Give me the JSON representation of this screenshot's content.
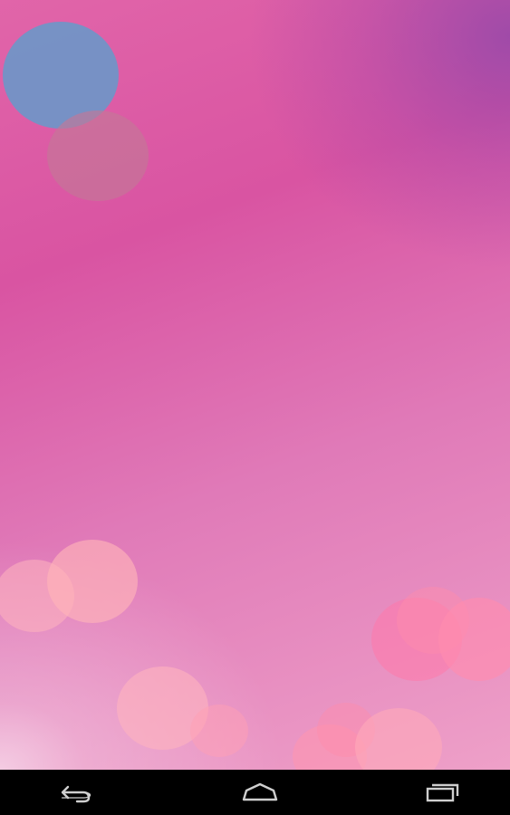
{
  "screen": {
    "type": "android-home-wallpaper"
  },
  "wallpaper": {
    "description_colors": {
      "base_pink": "#e165a9",
      "purple_corner": "#a050aa",
      "light_pink": "#eea0c8",
      "blue_bokeh": "#6e96c8"
    }
  },
  "navbar": {
    "background": "#000000",
    "icon_color": "#cfcfcf",
    "buttons": [
      {
        "name": "back",
        "icon": "back-arrow-icon"
      },
      {
        "name": "home",
        "icon": "home-icon"
      },
      {
        "name": "recents",
        "icon": "recent-apps-icon"
      }
    ]
  }
}
